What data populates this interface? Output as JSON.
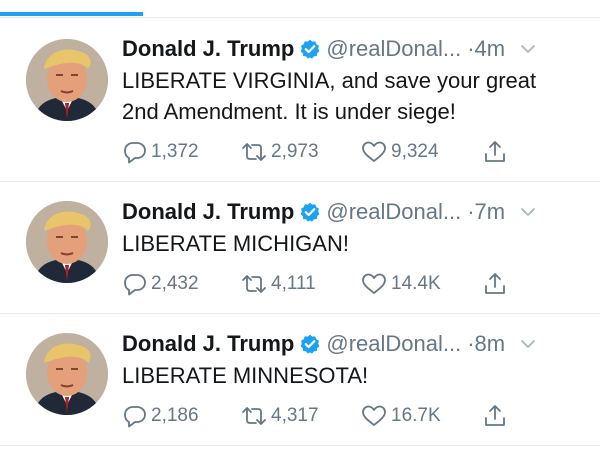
{
  "colors": {
    "accent": "#1da1f2",
    "text": "#14171a",
    "muted": "#657786",
    "divider": "#e6ecf0"
  },
  "tweets": [
    {
      "display_name": "Donald J. Trump",
      "handle": "@realDonal...",
      "time": "·4m",
      "lines": [
        "LIBERATE VIRGINIA, and save your great",
        "2nd Amendment. It is under siege!"
      ],
      "replies": "1,372",
      "retweets": "2,973",
      "likes": "9,324"
    },
    {
      "display_name": "Donald J. Trump",
      "handle": "@realDonal...",
      "time": "·7m",
      "lines": [
        "LIBERATE MICHIGAN!"
      ],
      "replies": "2,432",
      "retweets": "4,111",
      "likes": "14.4K"
    },
    {
      "display_name": "Donald J. Trump",
      "handle": "@realDonal...",
      "time": "·8m",
      "lines": [
        "LIBERATE MINNESOTA!"
      ],
      "replies": "2,186",
      "retweets": "4,317",
      "likes": "16.7K"
    }
  ],
  "icons": {
    "verified": "verified-badge-icon",
    "caret": "chevron-down-icon",
    "reply": "reply-icon",
    "retweet": "retweet-icon",
    "like": "heart-icon",
    "share": "share-icon"
  }
}
